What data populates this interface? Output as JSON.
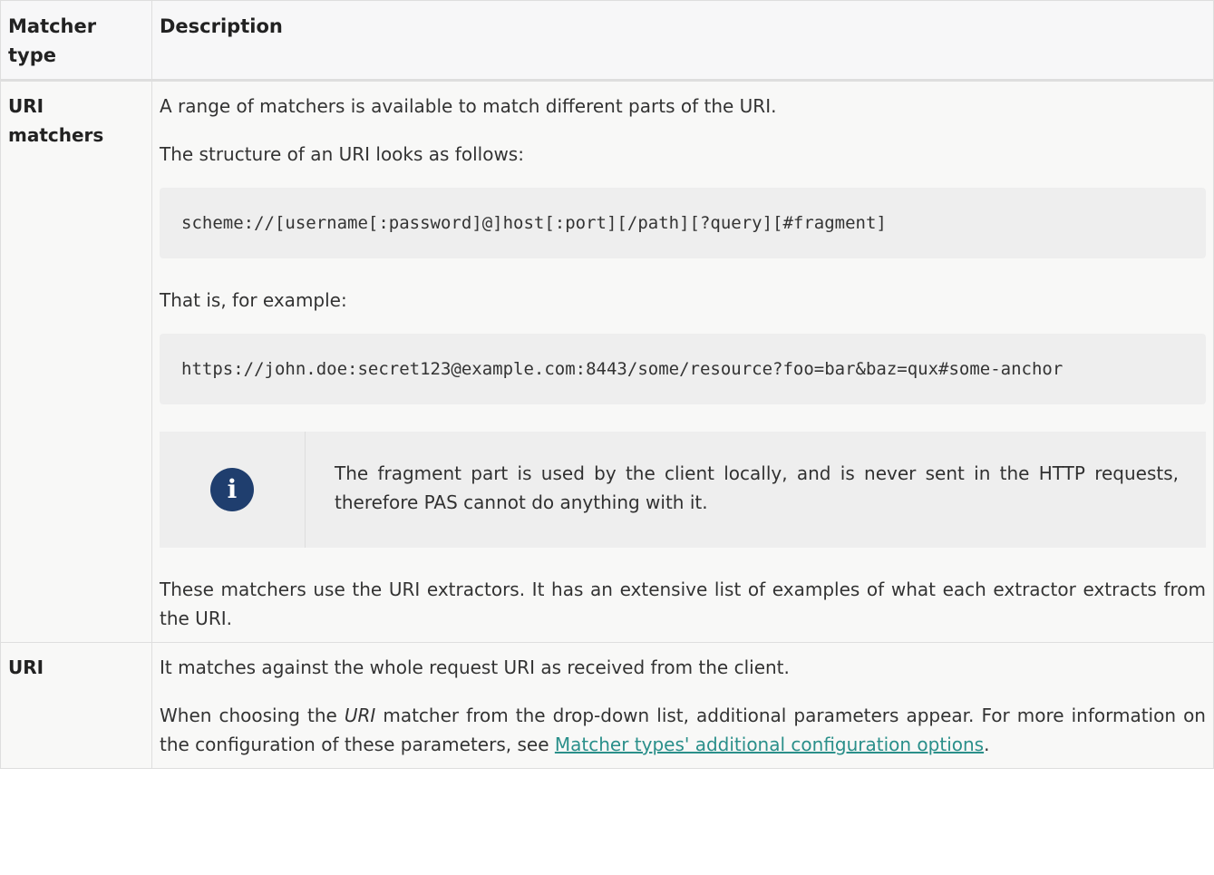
{
  "header": {
    "col1": "Matcher type",
    "col2": "Description"
  },
  "rows": [
    {
      "type": "URI matchers",
      "p1": "A range of matchers is available to match different parts of the URI.",
      "p2": "The structure of an URI looks as follows:",
      "code1": "scheme://[username[:password]@]host[:port][/path][?query][#fragment]",
      "p3": "That is, for example:",
      "code2": "https://john.doe:secret123@example.com:8443/some/resource?foo=bar&baz=qux#some-anchor",
      "note_icon": "info-icon",
      "note_icon_glyph": "i",
      "note": "The fragment part is used by the client locally, and is never sent in the HTTP requests, therefore PAS cannot do anything with it.",
      "p4": "These matchers use the URI extractors. It has an extensive list of examples of what each extractor extracts from the URI."
    },
    {
      "type": "URI",
      "p1": "It matches against the whole request URI as received from the client.",
      "p2_before": "When choosing the ",
      "p2_em": "URI",
      "p2_after": " matcher from the drop-down list, additional parameters appear. For more information on the configuration of these parameters, see ",
      "p2_link": "Matcher types' additional configuration options",
      "p2_end": "."
    }
  ],
  "colors": {
    "link": "#2a8f8a",
    "icon_bg": "#1f3e6e",
    "code_bg": "#eeeeee",
    "cell_bg": "#f8f8f7"
  }
}
